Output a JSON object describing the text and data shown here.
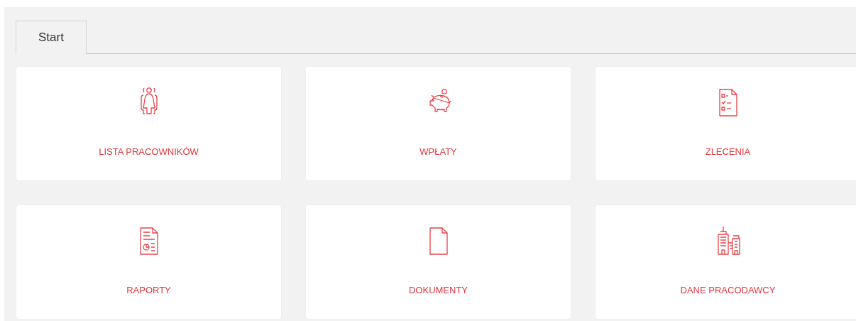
{
  "tabs": [
    {
      "label": "Start",
      "selected": true
    }
  ],
  "tiles": [
    {
      "label": "LISTA PRACOWNIKÓW",
      "kind": "people"
    },
    {
      "label": "WPŁATY",
      "kind": "piggy"
    },
    {
      "label": "ZLECENIA",
      "kind": "checklist"
    },
    {
      "label": "RAPORTY",
      "kind": "report"
    },
    {
      "label": "DOKUMENTY",
      "kind": "document"
    },
    {
      "label": "DANE PRACODAWCY",
      "kind": "buildings"
    }
  ]
}
